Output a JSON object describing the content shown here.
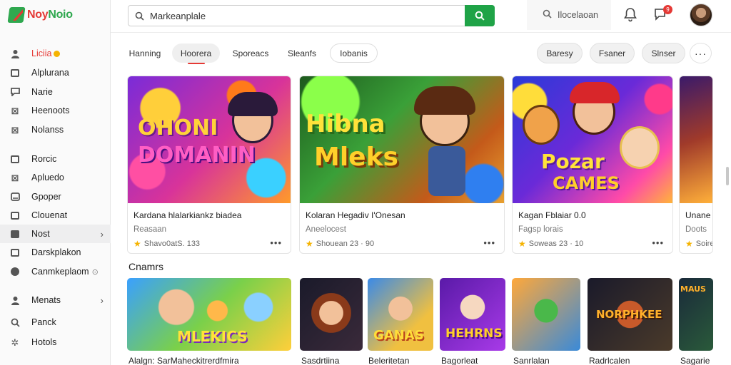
{
  "app": {
    "logo_part1": "Noy",
    "logo_part2": "Noio"
  },
  "header": {
    "search_value": "Markeanplale",
    "secondary_search_label": "Ilocelaoan",
    "notification_count": "9"
  },
  "sidebar": {
    "items": [
      {
        "label": "Liciia",
        "icon": "home-icon"
      },
      {
        "label": "Alplurana",
        "icon": "card-icon"
      },
      {
        "label": "Narie",
        "icon": "chat-icon"
      },
      {
        "label": "Heenoots",
        "icon": "cross-icon"
      },
      {
        "label": "Nolanss",
        "icon": "chart-icon"
      },
      {
        "label": "Rorcic",
        "icon": "card-icon"
      },
      {
        "label": "Apluedo",
        "icon": "cross-icon"
      },
      {
        "label": "Gpoper",
        "icon": "globe-icon"
      },
      {
        "label": "Clouenat",
        "icon": "card-icon"
      },
      {
        "label": "Nost",
        "icon": "folder-icon"
      },
      {
        "label": "Darskplakon",
        "icon": "card-icon"
      },
      {
        "label": "Canmkeplaom",
        "icon": "circle-icon"
      },
      {
        "label": "Menats",
        "icon": "people-icon"
      },
      {
        "label": "Panck",
        "icon": "search-icon"
      },
      {
        "label": "Hotols",
        "icon": "gear-icon"
      }
    ]
  },
  "tabs": {
    "items": [
      "Hanning",
      "Hoorera",
      "Sporeacs",
      "Sleanfs",
      "Iobanis"
    ],
    "active": "Hoorera"
  },
  "filters": [
    "Baresy",
    "Fsaner",
    "Slnser"
  ],
  "featured": [
    {
      "art_line1": "OHONI",
      "art_line2": "DOMANIN",
      "title": "Kardana hlalarkiankz biadea",
      "subtitle": "Reasaan",
      "meta": "Shavo0atS. 133"
    },
    {
      "art_line1": "Hibna",
      "art_line2": "Mleks",
      "title": "Kolaran Hegadiv I'Onesan",
      "subtitle": "Aneelocest",
      "meta": "Shouean 23 · 90"
    },
    {
      "art_line1": "Pozar",
      "art_line2": "CAMES",
      "title": "Kagan Fblaiar 0.0",
      "subtitle": "Fagsp lorais",
      "meta": "Soweas 23 · 10"
    },
    {
      "art_line1": "",
      "art_line2": "",
      "title": "Unane",
      "subtitle": "Doots",
      "meta": "Soire"
    }
  ],
  "section": {
    "title": "Cnamrs"
  },
  "thumbs": [
    {
      "art": "MLEKICS",
      "label": "Alalgn: SarMaheckitrerdfmira"
    },
    {
      "art": "",
      "label": "Sasdrtiina"
    },
    {
      "art": "GANAS",
      "label": "Beleritetan"
    },
    {
      "art": "HEHRNS",
      "label": "Bagorleat"
    },
    {
      "art": "",
      "label": "Sanrlalan"
    },
    {
      "art": "NORPHKEE",
      "label": "Radrlcalen"
    },
    {
      "art": "MAUS",
      "label": "Sagarie"
    }
  ],
  "colors": {
    "accent_green": "#1fa347",
    "accent_red": "#e53935",
    "star": "#f5b301"
  }
}
